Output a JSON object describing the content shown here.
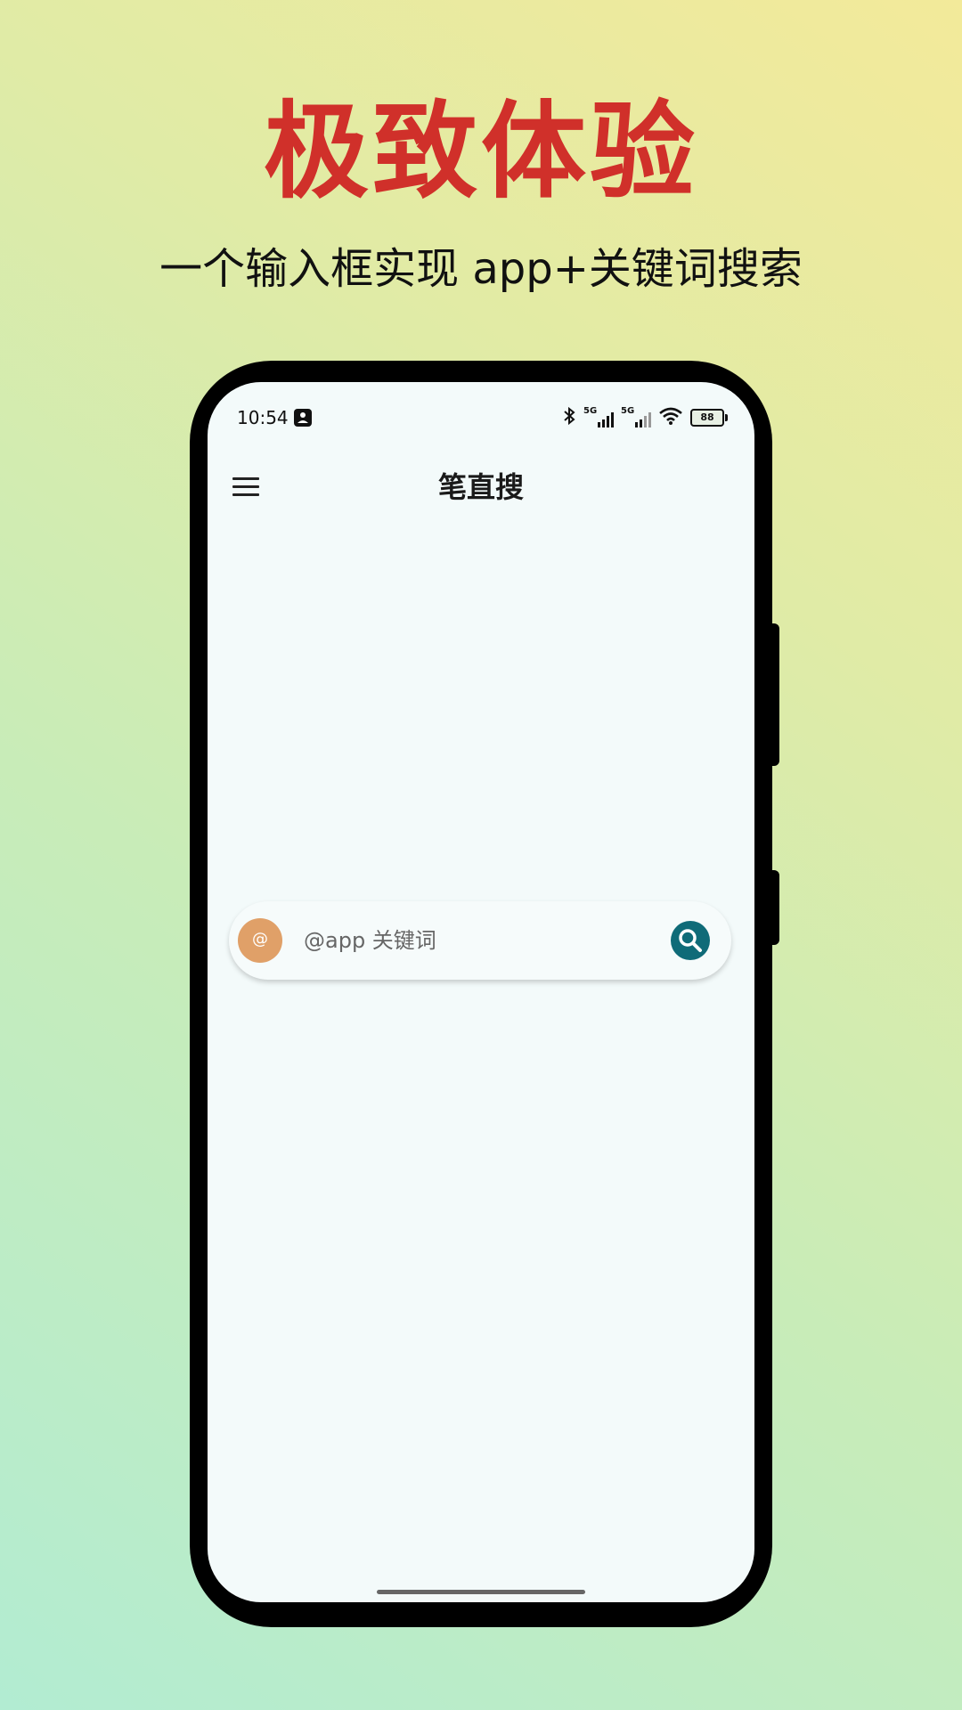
{
  "promo": {
    "headline": "极致体验",
    "subheadline": "一个输入框实现 app+关键词搜索",
    "headline_color": "#d0302a"
  },
  "status_bar": {
    "time": "10:54",
    "battery": "88",
    "signal_labels": [
      "5G",
      "5G"
    ]
  },
  "app_bar": {
    "title": "笔直搜"
  },
  "search": {
    "placeholder": "@app 关键词",
    "value": "",
    "at_symbol": "@",
    "at_button_color": "#e0a068",
    "search_button_color": "#0f6b78"
  },
  "icons": {
    "menu": "hamburger-menu-icon",
    "search": "magnifier-icon",
    "bluetooth": "bluetooth-icon",
    "wifi": "wifi-icon",
    "battery": "battery-icon",
    "notification": "photo-notification-icon"
  }
}
